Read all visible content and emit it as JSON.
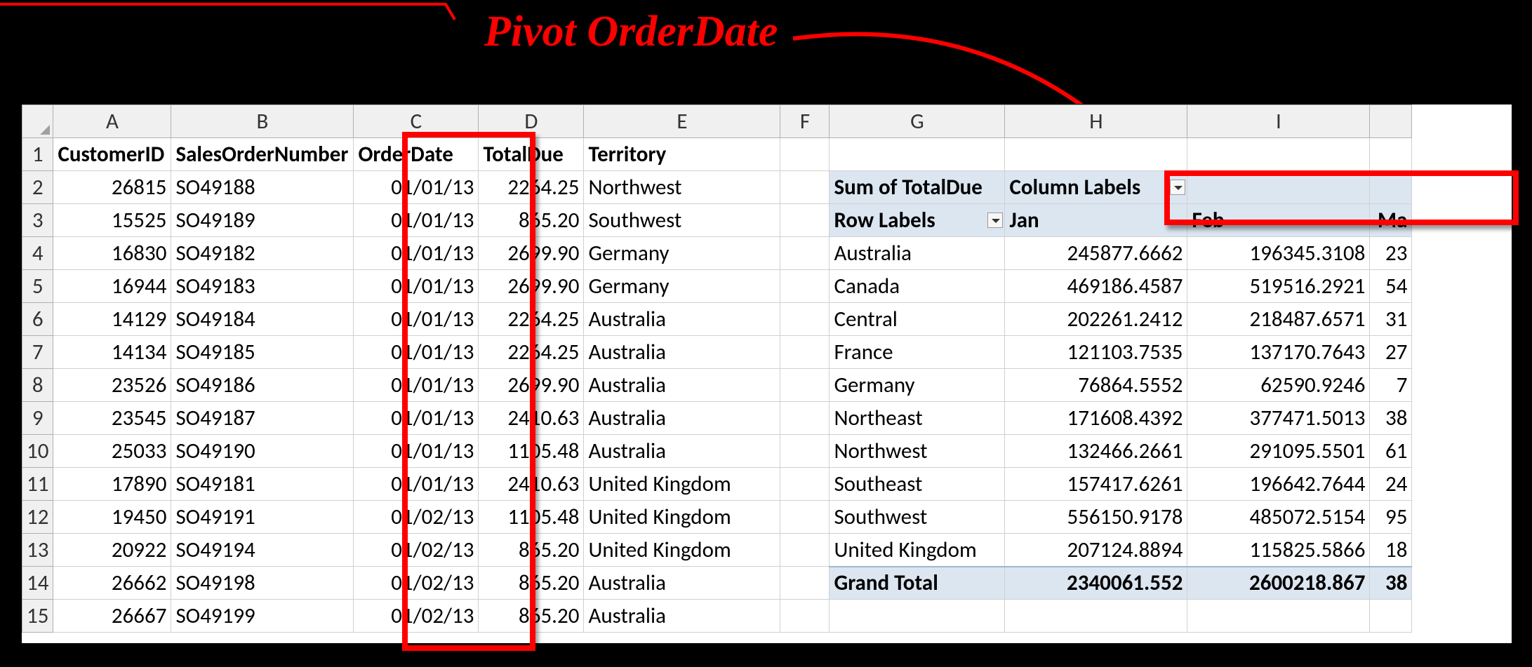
{
  "annotation": {
    "title": "Pivot OrderDate"
  },
  "cols": {
    "A": "A",
    "B": "B",
    "C": "C",
    "D": "D",
    "E": "E",
    "F": "F",
    "G": "G",
    "H": "H",
    "I": "I"
  },
  "rows": [
    "1",
    "2",
    "3",
    "4",
    "5",
    "6",
    "7",
    "8",
    "9",
    "10",
    "11",
    "12",
    "13",
    "14",
    "15"
  ],
  "headers": {
    "A": "CustomerID",
    "B": "SalesOrderNumber",
    "C": "OrderDate",
    "D": "TotalDue",
    "E": "Territory"
  },
  "orders": [
    {
      "cust": "26815",
      "so": "SO49188",
      "date": "01/01/13",
      "due": "2264.25",
      "terr": "Northwest"
    },
    {
      "cust": "15525",
      "so": "SO49189",
      "date": "01/01/13",
      "due": "865.20",
      "terr": "Southwest"
    },
    {
      "cust": "16830",
      "so": "SO49182",
      "date": "01/01/13",
      "due": "2699.90",
      "terr": "Germany"
    },
    {
      "cust": "16944",
      "so": "SO49183",
      "date": "01/01/13",
      "due": "2699.90",
      "terr": "Germany"
    },
    {
      "cust": "14129",
      "so": "SO49184",
      "date": "01/01/13",
      "due": "2264.25",
      "terr": "Australia"
    },
    {
      "cust": "14134",
      "so": "SO49185",
      "date": "01/01/13",
      "due": "2264.25",
      "terr": "Australia"
    },
    {
      "cust": "23526",
      "so": "SO49186",
      "date": "01/01/13",
      "due": "2699.90",
      "terr": "Australia"
    },
    {
      "cust": "23545",
      "so": "SO49187",
      "date": "01/01/13",
      "due": "2410.63",
      "terr": "Australia"
    },
    {
      "cust": "25033",
      "so": "SO49190",
      "date": "01/01/13",
      "due": "1105.48",
      "terr": "Australia"
    },
    {
      "cust": "17890",
      "so": "SO49181",
      "date": "01/01/13",
      "due": "2410.63",
      "terr": "United Kingdom"
    },
    {
      "cust": "19450",
      "so": "SO49191",
      "date": "01/02/13",
      "due": "1105.48",
      "terr": "United Kingdom"
    },
    {
      "cust": "20922",
      "so": "SO49194",
      "date": "01/02/13",
      "due": "865.20",
      "terr": "United Kingdom"
    },
    {
      "cust": "26662",
      "so": "SO49198",
      "date": "01/02/13",
      "due": "865.20",
      "terr": "Australia"
    },
    {
      "cust": "26667",
      "so": "SO49199",
      "date": "01/02/13",
      "due": "865.20",
      "terr": "Australia"
    }
  ],
  "pivot": {
    "sumLabel": "Sum of TotalDue",
    "colLabel": "Column Labels",
    "rowLabel": "Row Labels",
    "monthH": "Jan",
    "monthI": "Feb",
    "monthEdge": "Ma",
    "rows": [
      {
        "label": "Australia",
        "jan": "245877.6662",
        "feb": "196345.3108",
        "edge": "23"
      },
      {
        "label": "Canada",
        "jan": "469186.4587",
        "feb": "519516.2921",
        "edge": "54"
      },
      {
        "label": "Central",
        "jan": "202261.2412",
        "feb": "218487.6571",
        "edge": "31"
      },
      {
        "label": "France",
        "jan": "121103.7535",
        "feb": "137170.7643",
        "edge": "27"
      },
      {
        "label": "Germany",
        "jan": "76864.5552",
        "feb": "62590.9246",
        "edge": "7"
      },
      {
        "label": "Northeast",
        "jan": "171608.4392",
        "feb": "377471.5013",
        "edge": "38"
      },
      {
        "label": "Northwest",
        "jan": "132466.2661",
        "feb": "291095.5501",
        "edge": "61"
      },
      {
        "label": "Southeast",
        "jan": "157417.6261",
        "feb": "196642.7644",
        "edge": "24"
      },
      {
        "label": "Southwest",
        "jan": "556150.9178",
        "feb": "485072.5154",
        "edge": "95"
      },
      {
        "label": "United Kingdom",
        "jan": "207124.8894",
        "feb": "115825.5866",
        "edge": "18"
      }
    ],
    "totalLabel": "Grand Total",
    "totalJan": "2340061.552",
    "totalFeb": "2600218.867",
    "totalEdge": "38"
  }
}
